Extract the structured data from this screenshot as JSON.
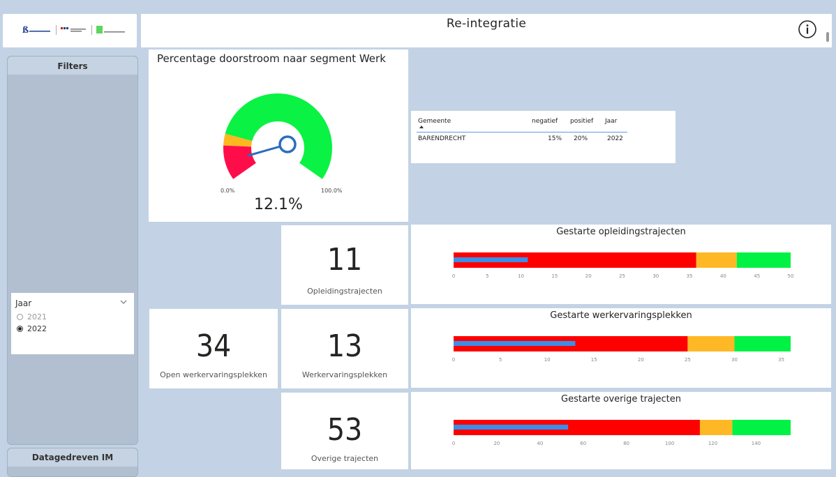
{
  "header": {
    "title": "Re-integratie",
    "info_icon": "info-icon"
  },
  "filters": {
    "title": "Filters",
    "jaar": {
      "label": "Jaar",
      "options": [
        "2021",
        "2022"
      ],
      "selected": "2022"
    }
  },
  "bottom_pane": {
    "title": "Datagedreven IM"
  },
  "gauge": {
    "title": "Percentage doorstroom naar segment Werk",
    "min_label": "0.0%",
    "max_label": "100.0%",
    "value_label": "12.1%",
    "value": 12.1,
    "negatief": 15,
    "positief": 20,
    "colors": {
      "low": "#ff0d4a",
      "mid": "#fdb820",
      "high": "#0af243",
      "needle": "#2a6ebd"
    }
  },
  "table": {
    "columns": [
      "Gemeente",
      "negatief",
      "positief",
      "Jaar"
    ],
    "rows": [
      [
        "BARENDRECHT",
        "15%",
        "20%",
        "2022"
      ]
    ]
  },
  "kpis": [
    {
      "value": "11",
      "label": "Opleidingstrajecten"
    },
    {
      "value": "34",
      "label": "Open werkervaringsplekken"
    },
    {
      "value": "13",
      "label": "Werkervaringsplekken"
    },
    {
      "value": "53",
      "label": "Overige trajecten"
    }
  ],
  "chart_data": [
    {
      "type": "bar",
      "title": "Gestarte opleidingstrajecten",
      "value": 11,
      "ranges": [
        36,
        42,
        50
      ],
      "xlim": [
        0,
        50
      ],
      "ticks": [
        "0",
        "5",
        "10",
        "15",
        "20",
        "25",
        "30",
        "35",
        "40",
        "45",
        "50"
      ]
    },
    {
      "type": "bar",
      "title": "Gestarte werkervaringsplekken",
      "value": 13,
      "ranges": [
        25,
        30,
        36
      ],
      "xlim": [
        0,
        36
      ],
      "ticks": [
        "0",
        "5",
        "10",
        "15",
        "20",
        "25",
        "30",
        "35"
      ]
    },
    {
      "type": "bar",
      "title": "Gestarte overige trajecten",
      "value": 53,
      "ranges": [
        114,
        129,
        156
      ],
      "xlim": [
        0,
        156
      ],
      "ticks": [
        "0",
        "20",
        "40",
        "60",
        "80",
        "100",
        "120",
        "140"
      ]
    }
  ],
  "colors": {
    "background": "#c3d3e5",
    "red": "#ff0000",
    "orange": "#ffb825",
    "green": "#00f244",
    "bar": "#3a8fe8"
  }
}
